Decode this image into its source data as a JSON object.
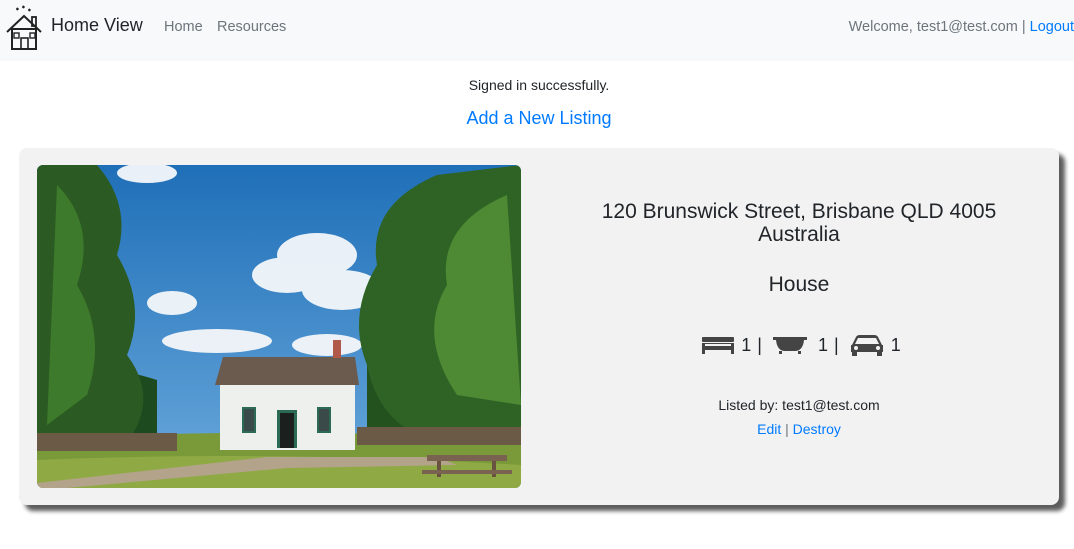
{
  "navbar": {
    "brand": "Home View",
    "links": [
      "Home",
      "Resources"
    ],
    "welcome_text": "Welcome, test1@test.com",
    "separator": "|",
    "logout_label": "Logout",
    "logo_icon": "house-logo-icon"
  },
  "flash": {
    "notice": "Signed in successfully."
  },
  "add_listing_label": "Add a New Listing",
  "listing": {
    "address": "120 Brunswick Street, Brisbane QLD 4005 Australia",
    "property_type": "House",
    "bedrooms": "1",
    "bathrooms": "1",
    "parking": "1",
    "feature_separator": "|",
    "listed_by": "Listed by: test1@test.com",
    "edit_label": "Edit",
    "action_separator": "|",
    "destroy_label": "Destroy",
    "icons": [
      "bed-icon",
      "bathtub-icon",
      "car-icon"
    ]
  },
  "colors": {
    "link": "#007bff",
    "navbar_bg": "#f8f9fa",
    "card_bg": "#f2f2f2"
  }
}
